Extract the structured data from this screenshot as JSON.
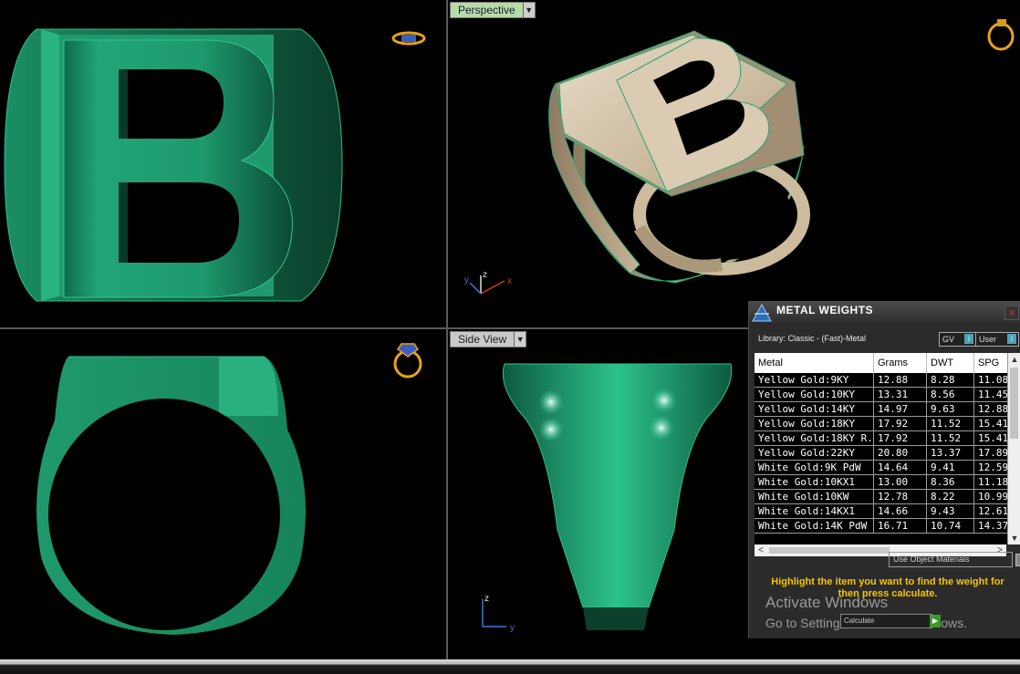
{
  "viewports": {
    "perspective_label": "Perspective",
    "side_label": "Side View",
    "axis_x": "x",
    "axis_y": "y",
    "axis_z": "z"
  },
  "panel": {
    "title": "METAL WEIGHTS",
    "close": "×",
    "library": "Library: Classic - (Fast)-Metal",
    "gv": "GV",
    "user": "User",
    "columns": [
      "Metal",
      "Grams",
      "DWT",
      "SPG"
    ],
    "rows": [
      [
        "Yellow Gold:9KY",
        "12.88",
        "8.28",
        "11.08"
      ],
      [
        "Yellow Gold:10KY",
        "13.31",
        "8.56",
        "11.45"
      ],
      [
        "Yellow Gold:14KY",
        "14.97",
        "9.63",
        "12.88"
      ],
      [
        "Yellow Gold:18KY",
        "17.92",
        "11.52",
        "15.41"
      ],
      [
        "Yellow Gold:18KY R...",
        "17.92",
        "11.52",
        "15.41"
      ],
      [
        "Yellow Gold:22KY",
        "20.80",
        "13.37",
        "17.89"
      ],
      [
        "White Gold:9K PdW",
        "14.64",
        "9.41",
        "12.59"
      ],
      [
        "White Gold:10KX1",
        "13.00",
        "8.36",
        "11.18"
      ],
      [
        "White Gold:10KW",
        "12.78",
        "8.22",
        "10.99"
      ],
      [
        "White Gold:14KX1",
        "14.66",
        "9.43",
        "12.61"
      ],
      [
        "White Gold:14K PdW",
        "16.71",
        "10.74",
        "14.37"
      ]
    ],
    "use_object_materials": "Use Object Materials",
    "hint": "Highlight the item you want to find the weight for then press calculate.",
    "calculate": "Calculate",
    "activate_title": "Activate Windows",
    "activate_sub": "Go to Settings to activate Windows."
  },
  "colors": {
    "ring_green": "#1f9a6c",
    "ring_gold": "#d9c8ad",
    "hint_yellow": "#f6c400"
  }
}
